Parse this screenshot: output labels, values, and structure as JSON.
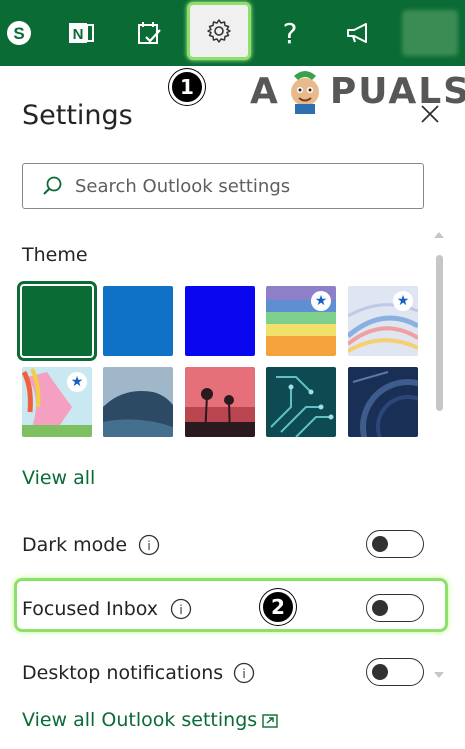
{
  "topbar": {
    "icons": [
      "skype-icon",
      "onenote-icon",
      "todo-icon",
      "settings-gear-icon",
      "help-icon",
      "feedback-megaphone-icon",
      "avatar"
    ],
    "skype_letter": "S",
    "onenote_letter": "N",
    "help_glyph": "?",
    "bg_color": "#0a6b34"
  },
  "watermark": {
    "left": "A",
    "right": "PUALS"
  },
  "steps": {
    "one": "1",
    "two": "2"
  },
  "settings": {
    "title": "Settings",
    "search_placeholder": "Search Outlook settings",
    "theme_label": "Theme",
    "themes": [
      {
        "name": "green",
        "selected": true
      },
      {
        "name": "blue"
      },
      {
        "name": "bright-blue"
      },
      {
        "name": "rainbow",
        "premium": true
      },
      {
        "name": "abstract",
        "premium": true
      },
      {
        "name": "unicorn",
        "premium": true
      },
      {
        "name": "coast"
      },
      {
        "name": "palms"
      },
      {
        "name": "circuit"
      },
      {
        "name": "innovation"
      }
    ],
    "star_glyph": "★",
    "view_all": "View all",
    "dark_mode": "Dark mode",
    "focused_inbox": "Focused Inbox",
    "desktop_notifications": "Desktop notifications",
    "view_all_settings": "View all Outlook settings",
    "info_glyph": "i"
  },
  "colors": {
    "accent": "#0a6b34",
    "highlight": "#8fe06a"
  }
}
